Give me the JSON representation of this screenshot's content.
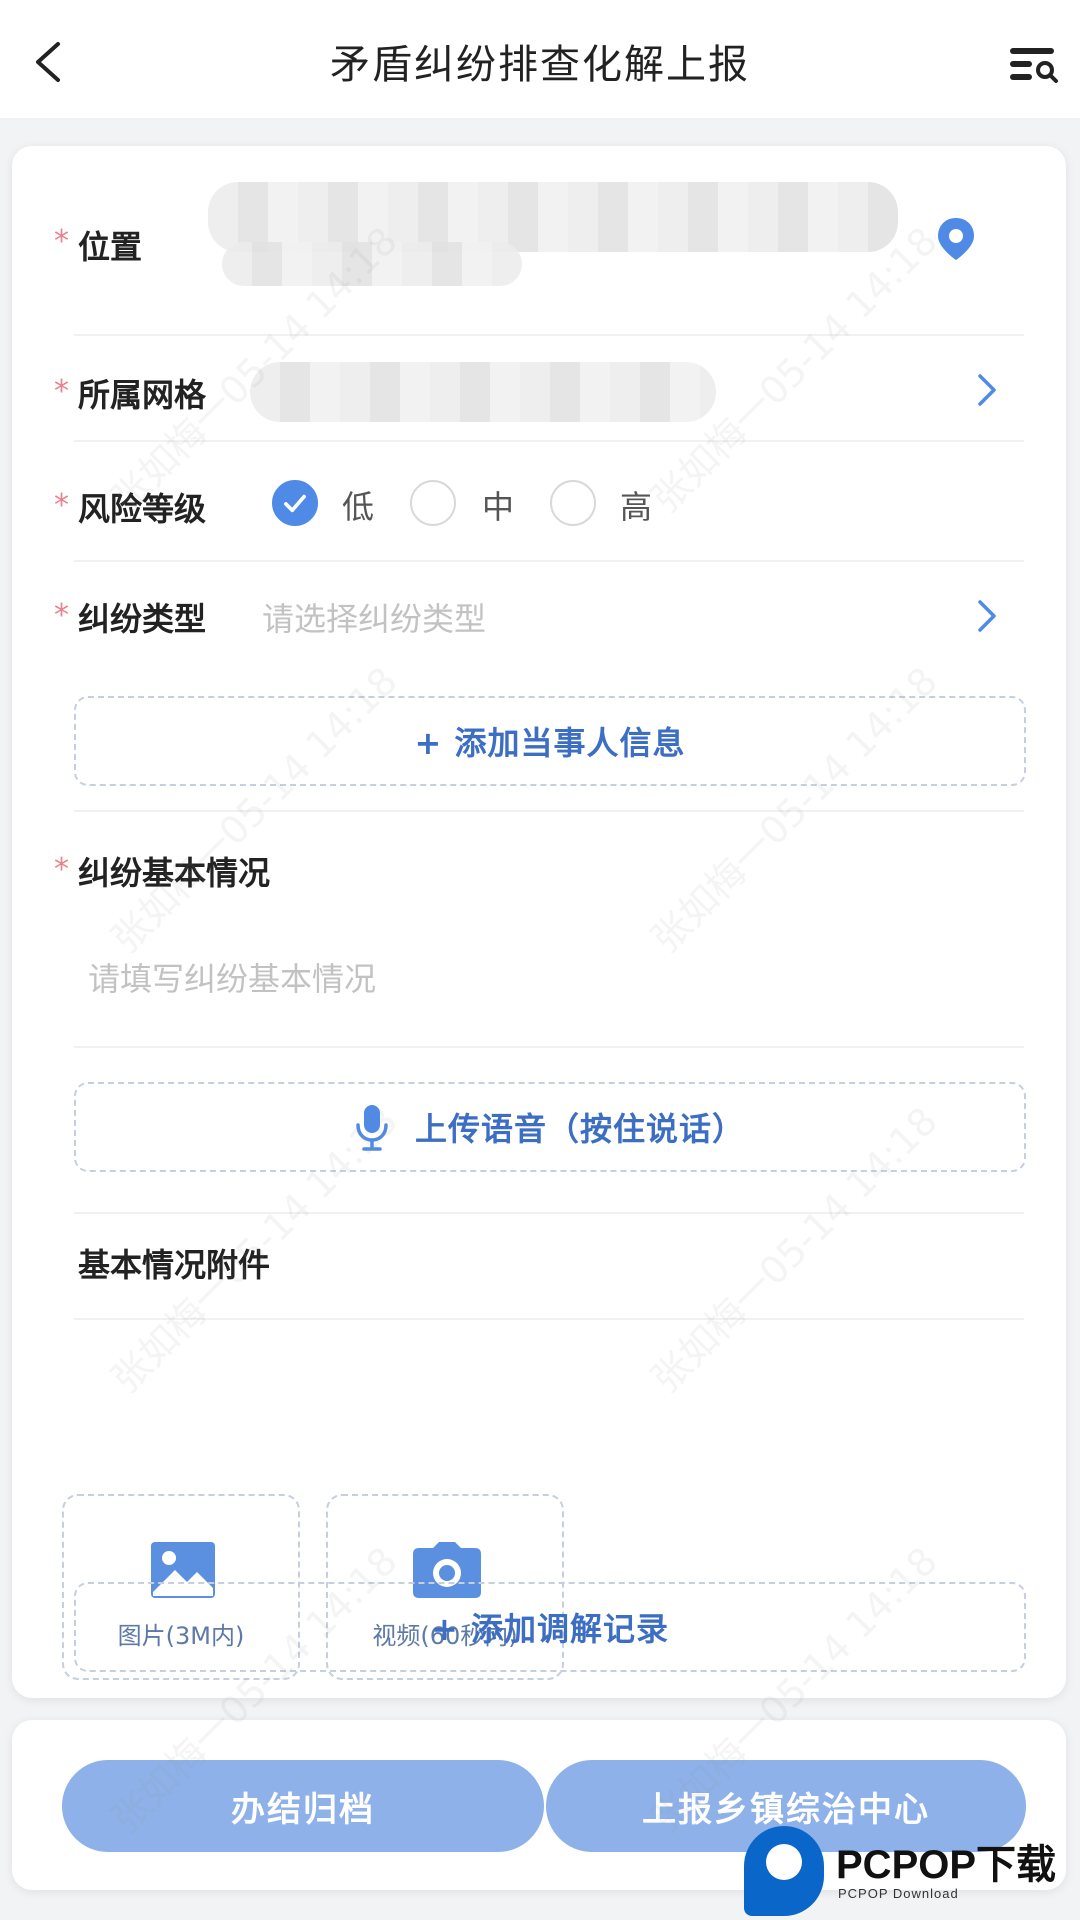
{
  "header": {
    "title": "矛盾纠纷排查化解上报"
  },
  "form": {
    "location": {
      "required_mark": "*",
      "label": "位置"
    },
    "grid": {
      "required_mark": "*",
      "label": "所属网格"
    },
    "risk": {
      "required_mark": "*",
      "label": "风险等级",
      "options": [
        "低",
        "中",
        "高"
      ],
      "selected": "低"
    },
    "dispute_type": {
      "required_mark": "*",
      "label": "纠纷类型",
      "placeholder": "请选择纠纷类型"
    },
    "add_party_label": "+ 添加当事人信息",
    "basic": {
      "required_mark": "*",
      "label": "纠纷基本情况",
      "placeholder": "请填写纠纷基本情况"
    },
    "voice_label": "上传语音（按住说话）",
    "attachments": {
      "label": "基本情况附件",
      "image_label": "图片(3M内)",
      "video_label": "视频(60秒内)"
    },
    "add_mediation_label": "+ 添加调解记录"
  },
  "footer": {
    "close_label": "办结归档",
    "report_label": "上报乡镇综治中心"
  },
  "watermark_text": "张如梅一05-14 14:18",
  "brand": {
    "name": "PCPOP下载",
    "sub": "PCPOP Download"
  },
  "colors": {
    "accent": "#4f8ae6",
    "button": "#8db1e8",
    "required": "#e8828c",
    "link": "#3c6ec4"
  }
}
